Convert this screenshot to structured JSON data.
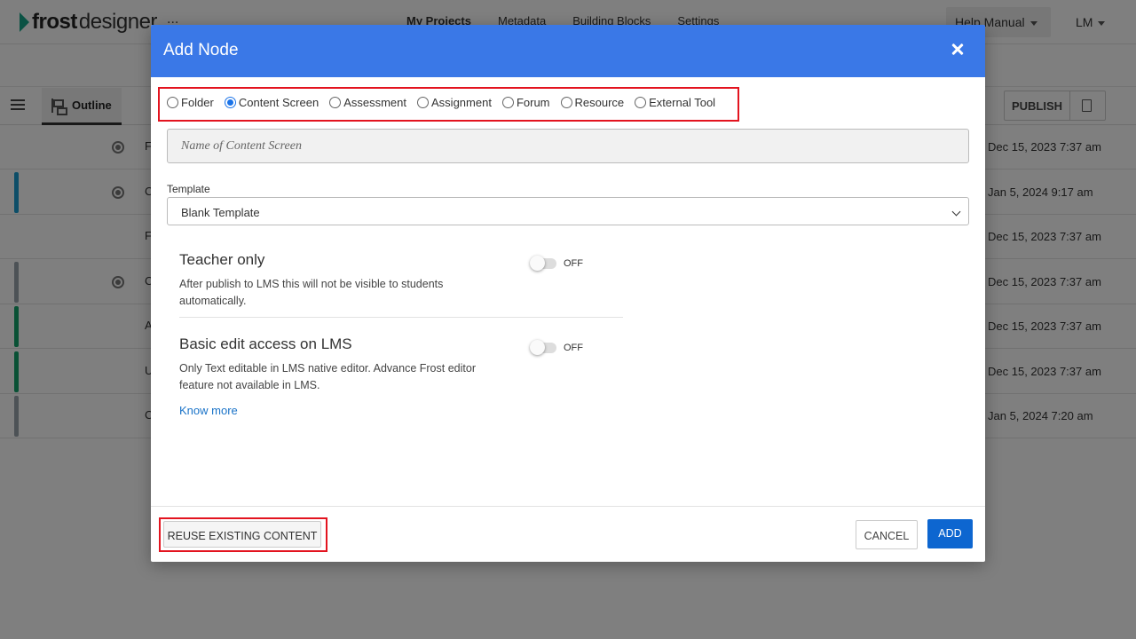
{
  "app": {
    "logo_brand": "frost",
    "logo_suffix": "designer",
    "more": "...",
    "menu": [
      "My Projects",
      "Metadata",
      "Building Blocks",
      "Settings"
    ],
    "help": "Help Manual",
    "user": "LM"
  },
  "toolbar": {
    "outline_tab": "Outline",
    "publish": "PUBLISH"
  },
  "rows": [
    {
      "letter": "F",
      "date": "Dec 15, 2023 7:37 am",
      "bar": "",
      "gear": true
    },
    {
      "letter": "C",
      "date": "Jan 5, 2024 9:17 am",
      "bar": "#1b9dd1",
      "gear": true
    },
    {
      "letter": "F",
      "date": "Dec 15, 2023 7:37 am",
      "bar": "",
      "gear": false
    },
    {
      "letter": "C",
      "date": "Dec 15, 2023 7:37 am",
      "bar": "#9aa5ac",
      "gear": true
    },
    {
      "letter": "A",
      "date": "Dec 15, 2023 7:37 am",
      "bar": "#12a36b",
      "gear": false
    },
    {
      "letter": "U",
      "date": "Dec 15, 2023 7:37 am",
      "bar": "#12a36b",
      "gear": false
    },
    {
      "letter": "C",
      "date": "Jan 5, 2024 7:20 am",
      "bar": "#9aa5ac",
      "gear": false
    }
  ],
  "modal": {
    "title": "Add Node",
    "node_types": [
      "Folder",
      "Content Screen",
      "Assessment",
      "Assignment",
      "Forum",
      "Resource",
      "External Tool"
    ],
    "selected_type": "Content Screen",
    "name_placeholder": "Name of Content Screen",
    "template_label": "Template",
    "template_value": "Blank Template",
    "teacher_only": {
      "title": "Teacher only",
      "desc": "After publish to LMS this will not be visible to students automatically.",
      "state": "OFF"
    },
    "basic_edit": {
      "title": "Basic edit access on LMS",
      "desc": "Only Text editable in LMS native editor. Advance Frost editor feature not available in LMS.",
      "state": "OFF"
    },
    "know_more": "Know more",
    "reuse_button": "REUSE EXISTING CONTENT",
    "cancel_button": "CANCEL",
    "add_button": "ADD"
  },
  "colors": {
    "header": "#3a78e7",
    "primary_button": "#0d66d0",
    "highlight": "#e3141f",
    "logo_accent": "#17a589"
  }
}
